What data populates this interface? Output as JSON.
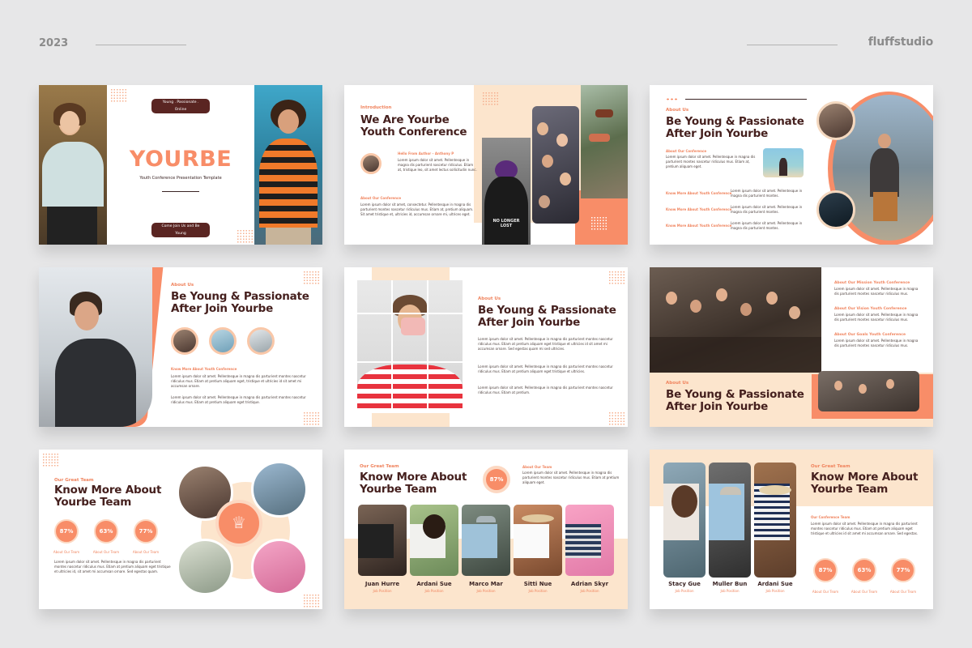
{
  "header": {
    "year": "2023",
    "brand": "fluffstudio"
  },
  "s1": {
    "pill_top": "Young . Passionate . Online",
    "title": "YOURBE",
    "subtitle": "Youth Conference Presentation Template",
    "pill_bottom": "Come Join Us and Be Young"
  },
  "s2": {
    "eyebrow": "Introduction",
    "title1": "We Are Yourbe",
    "title2": "Youth Conference",
    "author": "Hello From Author – Anthony P",
    "about": "About Our Conference",
    "shirt": "NO LONGER LOST"
  },
  "s3": {
    "eyebrow": "About Us",
    "title1": "Be Young & Passionate",
    "title2": "After Join Yourbe",
    "about": "About Our Conference",
    "more1": "Know More About Youth Conference",
    "more2": "Know More About Youth Conference",
    "more3": "Know More About Youth Conference"
  },
  "s4": {
    "eyebrow": "About Us",
    "title1": "Be Young & Passionate",
    "title2": "After Join Yourbe",
    "more": "Know More About Youth Conference"
  },
  "s5": {
    "eyebrow": "About Us",
    "title1": "Be Young & Passionate",
    "title2": "After Join Yourbe"
  },
  "s6": {
    "l1": "About Our Mission Youth Conference",
    "l2": "About Our Vision Youth Conference",
    "l3": "About Our Goals Youth Conference",
    "eyebrow": "About Us",
    "title1": "Be Young & Passionate",
    "title2": "After Join Yourbe"
  },
  "s7": {
    "eyebrow": "Our Great Team",
    "title1": "Know More About",
    "title2": "Yourbe Team",
    "stats": [
      {
        "value": "87%",
        "label": "About Our Team"
      },
      {
        "value": "63%",
        "label": "About Our Team"
      },
      {
        "value": "77%",
        "label": "About Our Team"
      }
    ]
  },
  "s8": {
    "eyebrow": "Our Great Team",
    "title1": "Know More About",
    "title2": "Yourbe Team",
    "stat": "87%",
    "stat_label": "About Our Team",
    "members": [
      {
        "name": "Juan Hurre",
        "role": "Job Position"
      },
      {
        "name": "Ardani Sue",
        "role": "Job Position"
      },
      {
        "name": "Marco Mar",
        "role": "Job Position"
      },
      {
        "name": "Sitti Nue",
        "role": "Job Position"
      },
      {
        "name": "Adrian Skyr",
        "role": "Job Position"
      }
    ]
  },
  "s9": {
    "eyebrow": "Our Great Team",
    "title1": "Know More About",
    "title2": "Yourbe Team",
    "about": "Our Conference Team",
    "members": [
      {
        "name": "Stacy Gue",
        "role": "Job Position"
      },
      {
        "name": "Muller Bun",
        "role": "Job Position"
      },
      {
        "name": "Ardani Sue",
        "role": "Job Position"
      }
    ],
    "stats": [
      {
        "value": "87%",
        "label": "About Our Team"
      },
      {
        "value": "63%",
        "label": "About Our Team"
      },
      {
        "value": "77%",
        "label": "About Our Team"
      }
    ]
  },
  "colors": {
    "accent": "#f88d68",
    "peach": "#fce5cd",
    "dark": "#45201e",
    "background": "#e7e7e8"
  }
}
